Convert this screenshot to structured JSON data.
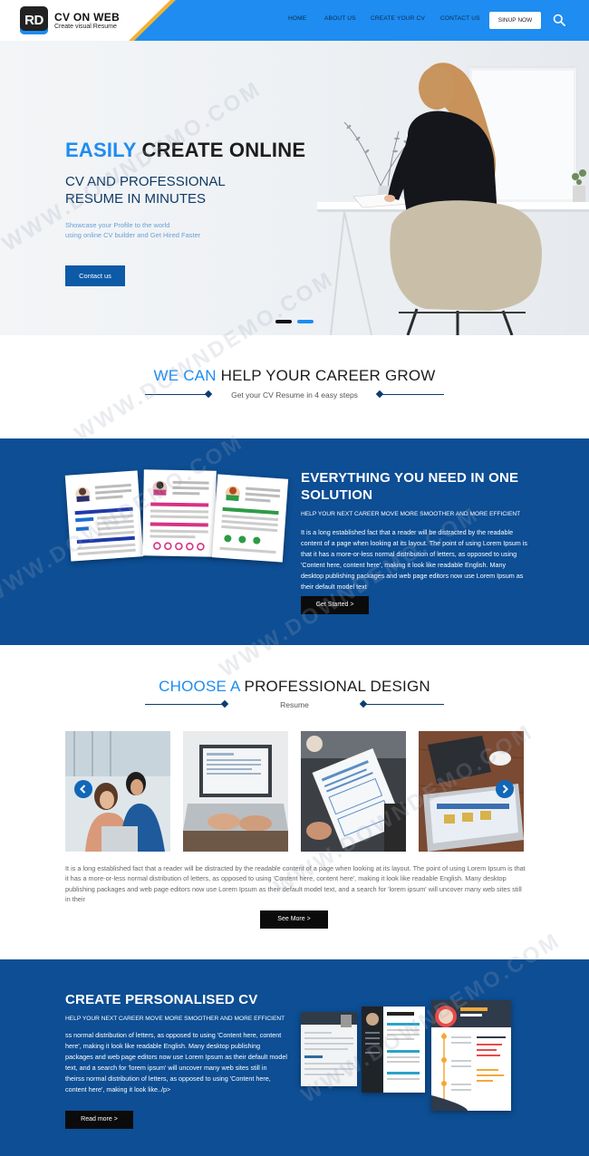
{
  "nav": {
    "logo_mark": "RD",
    "logo_title": "CV ON WEB",
    "logo_sub": "Create visual Resume",
    "items": [
      "HOME",
      "ABOUT US",
      "CREATE YOUR CV",
      "CONTACT US"
    ],
    "signup": "SINUP NOW",
    "search_icon": "search-icon"
  },
  "hero": {
    "title_accent": "EASILY",
    "title_rest": " CREATE ONLINE",
    "subtitle_line1": "CV AND PROFESSIONAL",
    "subtitle_line2": "RESUME IN MINUTES",
    "text_line1": "Showcase your Profile to the world",
    "text_line2": "using online CV builder and Get Hired Faster",
    "button": "Contact us",
    "active_slide": 2,
    "slide_count": 2
  },
  "help": {
    "title_accent": "WE CAN",
    "title_rest": " HELP YOUR CAREER GROW",
    "subtitle": "Get your CV Resume in 4 easy steps"
  },
  "solution": {
    "title_line1": "EVERYTHING YOU NEED IN ONE",
    "title_line2": "SOLUTION",
    "lead": "HELP YOUR NEXT CAREER MOVE MORE SMOOTHER AND MORE EFFICIENT",
    "body": "It is a long established fact that a reader will be distracted by the readable content of a page when looking at its layout. The point of using Lorem Ipsum is that it has a more-or-less normal distribution of letters, as opposed to using 'Content here, content here', making it look like readable English. Many desktop publishing packages and web page editors now use Lorem Ipsum as their default model text",
    "button": "Get Started >"
  },
  "design": {
    "title_accent": "CHOOSE A",
    "title_rest": " PROFESSIONAL DESIGN",
    "subtitle": "Resume",
    "body": "It is a long established fact that a reader will be distracted by the readable content of a page when looking at its layout. The point of using Lorem Ipsum is that it has a more-or-less normal distribution of letters, as opposed to using 'Content here, content here', making it look like readable English. Many desktop publishing packages and web page editors now use Lorem Ipsum as their default model text, and a search for 'lorem ipsum' will uncover many web sites still in their",
    "button": "See More >",
    "prev_icon": "chevron-left-icon",
    "next_icon": "chevron-right-icon"
  },
  "personal": {
    "title": "CREATE PERSONALISED CV",
    "lead": "HELP YOUR NEXT CAREER MOVE MORE SMOOTHER AND MORE EFFICIENT",
    "body": "ss normal distribution of letters, as opposed to using 'Content here, content here', making it look like readable English. Many desktop publishing packages and web page editors now use Lorem Ipsum as their default model text, and a search for 'lorem ipsum' will uncover many web sites still in theirss normal distribution of letters, as opposed to using 'Content here, content here', making it look like../p>",
    "button": "Read more >"
  },
  "watermark": "WWW.DOWNDEMO.COM",
  "colors": {
    "accent": "#1e8cf0",
    "navy": "#0d4e94",
    "button_dark": "#0b0b0b",
    "nav_stripe": "#f2b233"
  }
}
